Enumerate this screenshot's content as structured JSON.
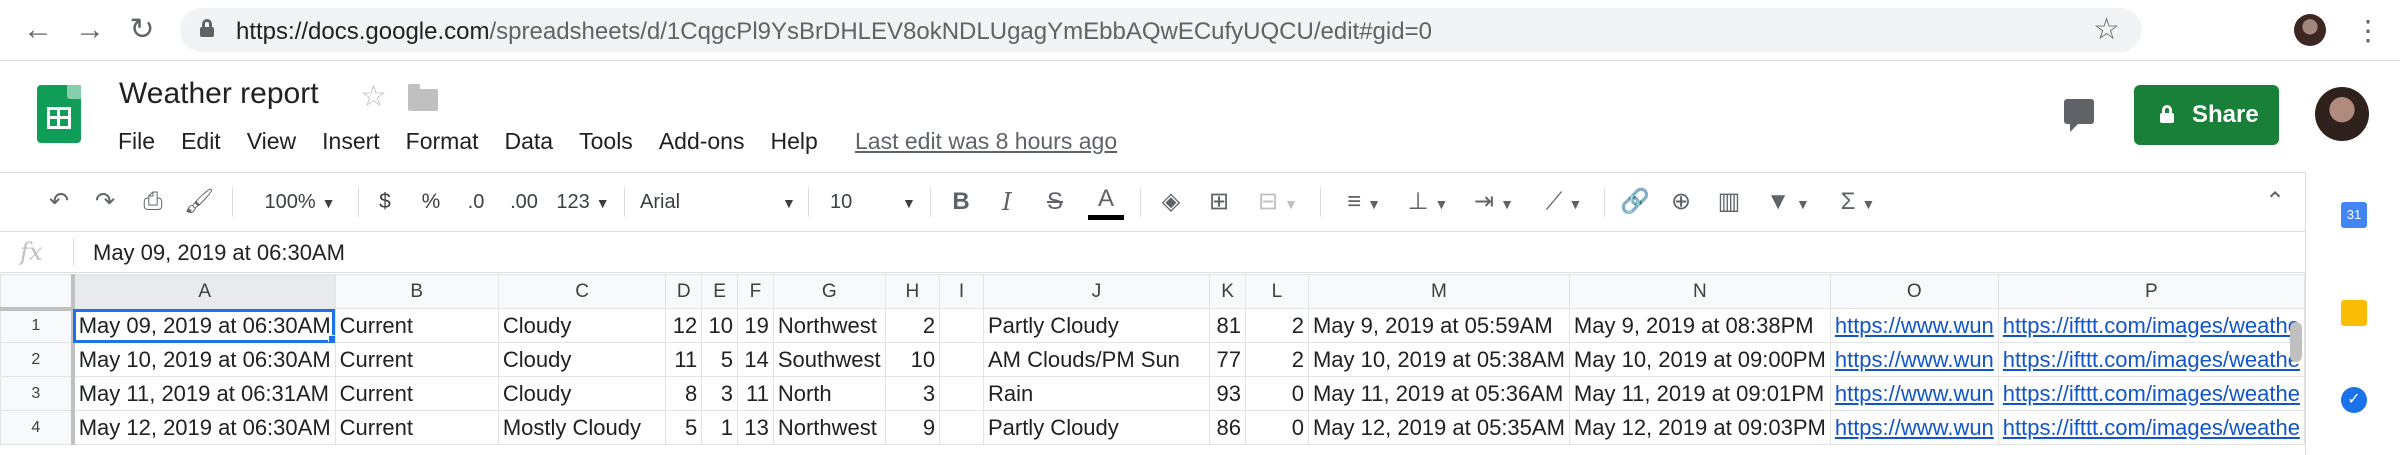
{
  "browser": {
    "url_host": "https://docs.google.com",
    "url_path": "/spreadsheets/d/1CqgcPl9YsBrDHLEV8okNDLUgagYmEbbAQwECufyUQCU/edit#gid=0"
  },
  "doc": {
    "title": "Weather report",
    "menu": [
      "File",
      "Edit",
      "View",
      "Insert",
      "Format",
      "Data",
      "Tools",
      "Add-ons",
      "Help"
    ],
    "last_edit": "Last edit was 8 hours ago",
    "share_label": "Share"
  },
  "toolbar": {
    "zoom": "100%",
    "currency": "$",
    "percent": "%",
    "dec_less": ".0",
    "dec_more": ".00",
    "more_formats": "123",
    "font": "Arial",
    "font_size": "10",
    "bold": "B",
    "italic": "I",
    "strike": "S",
    "text_color": "A",
    "sum": "Σ"
  },
  "formula_bar": {
    "fx": "fx",
    "value": "May 09, 2019 at 06:30AM"
  },
  "sheet": {
    "columns": [
      "A",
      "B",
      "C",
      "D",
      "E",
      "F",
      "G",
      "H",
      "I",
      "J",
      "K",
      "L",
      "M",
      "N",
      "O",
      "P"
    ],
    "rows": [
      {
        "num": "1",
        "cells": [
          "May 09, 2019 at 06:30AM",
          "Current",
          "Cloudy",
          "12",
          "10",
          "19",
          "Northwest",
          "2",
          "",
          "Partly Cloudy",
          "81",
          "2",
          "May 9, 2019 at 05:59AM",
          "May 9, 2019 at 08:38PM",
          "https://www.wun",
          "https://ifttt.com/images/weathe"
        ]
      },
      {
        "num": "2",
        "cells": [
          "May 10, 2019 at 06:30AM",
          "Current",
          "Cloudy",
          "11",
          "5",
          "14",
          "Southwest",
          "10",
          "",
          "AM Clouds/PM Sun",
          "77",
          "2",
          "May 10, 2019 at 05:38AM",
          "May 10, 2019 at 09:00PM",
          "https://www.wun",
          "https://ifttt.com/images/weathe"
        ]
      },
      {
        "num": "3",
        "cells": [
          "May 11, 2019 at 06:31AM",
          "Current",
          "Cloudy",
          "8",
          "3",
          "11",
          "North",
          "3",
          "",
          "Rain",
          "93",
          "0",
          "May 11, 2019 at 05:36AM",
          "May 11, 2019 at 09:01PM",
          "https://www.wun",
          "https://ifttt.com/images/weathe"
        ]
      },
      {
        "num": "4",
        "cells": [
          "May 12, 2019 at 06:30AM",
          "Current",
          "Mostly Cloudy",
          "5",
          "1",
          "13",
          "Northwest",
          "9",
          "",
          "Partly Cloudy",
          "86",
          "0",
          "May 12, 2019 at 05:35AM",
          "May 12, 2019 at 09:03PM",
          "https://www.wun",
          "https://ifttt.com/images/weathe"
        ]
      }
    ]
  },
  "side": {
    "calendar_day": "31"
  }
}
